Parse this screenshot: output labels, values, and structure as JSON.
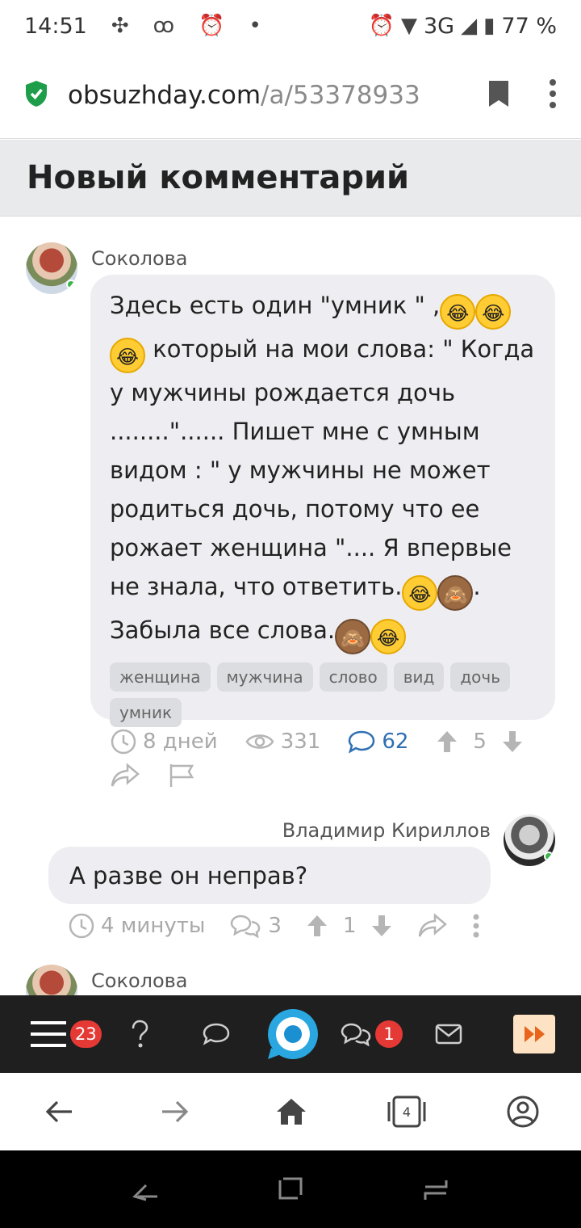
{
  "status": {
    "time": "14:51",
    "network": "3G",
    "battery": "77 %"
  },
  "browser": {
    "url_host": "obsuzhday.com",
    "url_path": "/a/53378933"
  },
  "page": {
    "title": "Новый комментарий"
  },
  "post": {
    "author": "Соколова",
    "text_1": "Здесь есть один \"умник \" ,",
    "text_2": " который на мои слова: \" Когда у мужчины рождается дочь ........\"...... Пишет мне с умным видом : \" у мужчины не может родиться дочь, потому что ее рожает женщина \".... Я впервые не знала, что ответить.",
    "text_3": ". Забыла все слова.",
    "tags": [
      "женщина",
      "мужчина",
      "слово",
      "вид",
      "дочь",
      "умник"
    ],
    "time": "8 дней",
    "views": "331",
    "comments": "62",
    "votes": "5"
  },
  "reply": {
    "author": "Владимир Кириллов",
    "text": "А разве он неправ?",
    "time": "4 минуты",
    "comments": "3",
    "votes": "1"
  },
  "next": {
    "author": "Соколова"
  },
  "toolbar": {
    "menu_badge": "23",
    "chat_badge": "1"
  },
  "browser_nav": {
    "tabs_count": "4"
  },
  "colors": {
    "accent": "#2f6fb3",
    "badge": "#e53935",
    "online": "#3cb54a",
    "bubble": "#eeeef2"
  }
}
